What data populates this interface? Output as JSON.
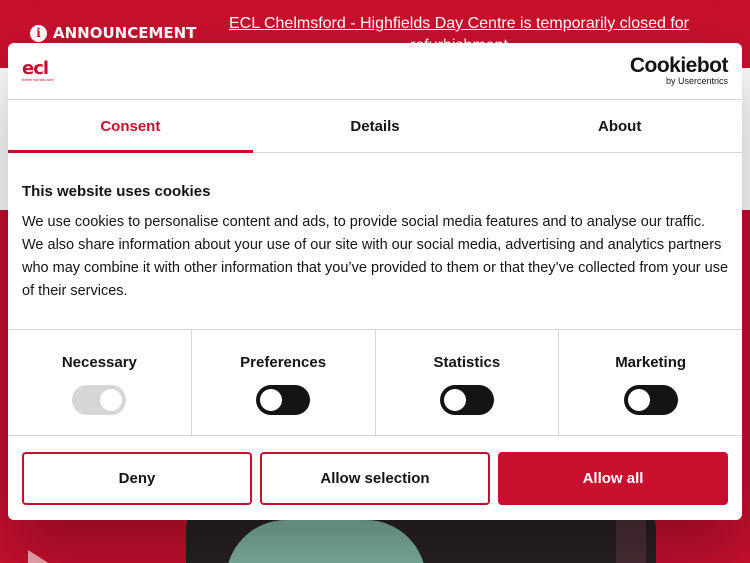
{
  "announcement": {
    "label": "ANNOUNCEMENT",
    "icon": "info-icon",
    "link_text": "ECL Chelmsford - Highfields Day Centre is temporarily closed for refurbishment"
  },
  "dialog": {
    "brand_logo": "ecl",
    "brand_tagline": "better worlds care",
    "provider_name": "Cookiebot",
    "provider_by": "by Usercentrics",
    "tabs": [
      {
        "label": "Consent",
        "active": true
      },
      {
        "label": "Details",
        "active": false
      },
      {
        "label": "About",
        "active": false
      }
    ],
    "title": "This website uses cookies",
    "description": "We use cookies to personalise content and ads, to provide social media features and to analyse our traffic. We also share information about your use of our site with our social media, advertising and analytics partners who may combine it with other information that you’ve provided to them or that they’ve collected from your use of their services.",
    "toggles": [
      {
        "label": "Necessary",
        "checked": true,
        "disabled": true
      },
      {
        "label": "Preferences",
        "checked": false,
        "disabled": false
      },
      {
        "label": "Statistics",
        "checked": false,
        "disabled": false
      },
      {
        "label": "Marketing",
        "checked": false,
        "disabled": false
      }
    ],
    "buttons": {
      "deny": "Deny",
      "allow_selection": "Allow selection",
      "allow_all": "Allow all"
    }
  },
  "colors": {
    "brand": "#c8102e",
    "text": "#141414",
    "divider": "#d6d6d6"
  }
}
